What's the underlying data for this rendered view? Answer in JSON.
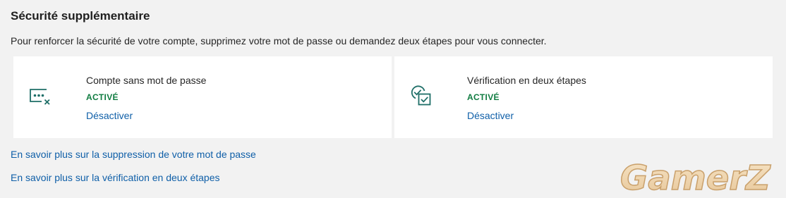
{
  "section": {
    "title": "Sécurité supplémentaire",
    "description": "Pour renforcer la sécurité de votre compte, supprimez votre mot de passe ou demandez deux étapes pour vous connecter."
  },
  "cards": [
    {
      "icon": "passwordless-icon",
      "title": "Compte sans mot de passe",
      "status": "ACTIVÉ",
      "action": "Désactiver"
    },
    {
      "icon": "two-step-verification-icon",
      "title": "Vérification en deux étapes",
      "status": "ACTIVÉ",
      "action": "Désactiver"
    }
  ],
  "links": {
    "remove_password": "En savoir plus sur la suppression de votre mot de passe",
    "two_step": "En savoir plus sur la vérification en deux étapes"
  },
  "watermark": {
    "text": "GamerZ"
  },
  "colors": {
    "background": "#f2f2f2",
    "card": "#ffffff",
    "accent_green": "#107c41",
    "link_blue": "#0f5fa8",
    "icon_teal": "#1f6f68"
  }
}
